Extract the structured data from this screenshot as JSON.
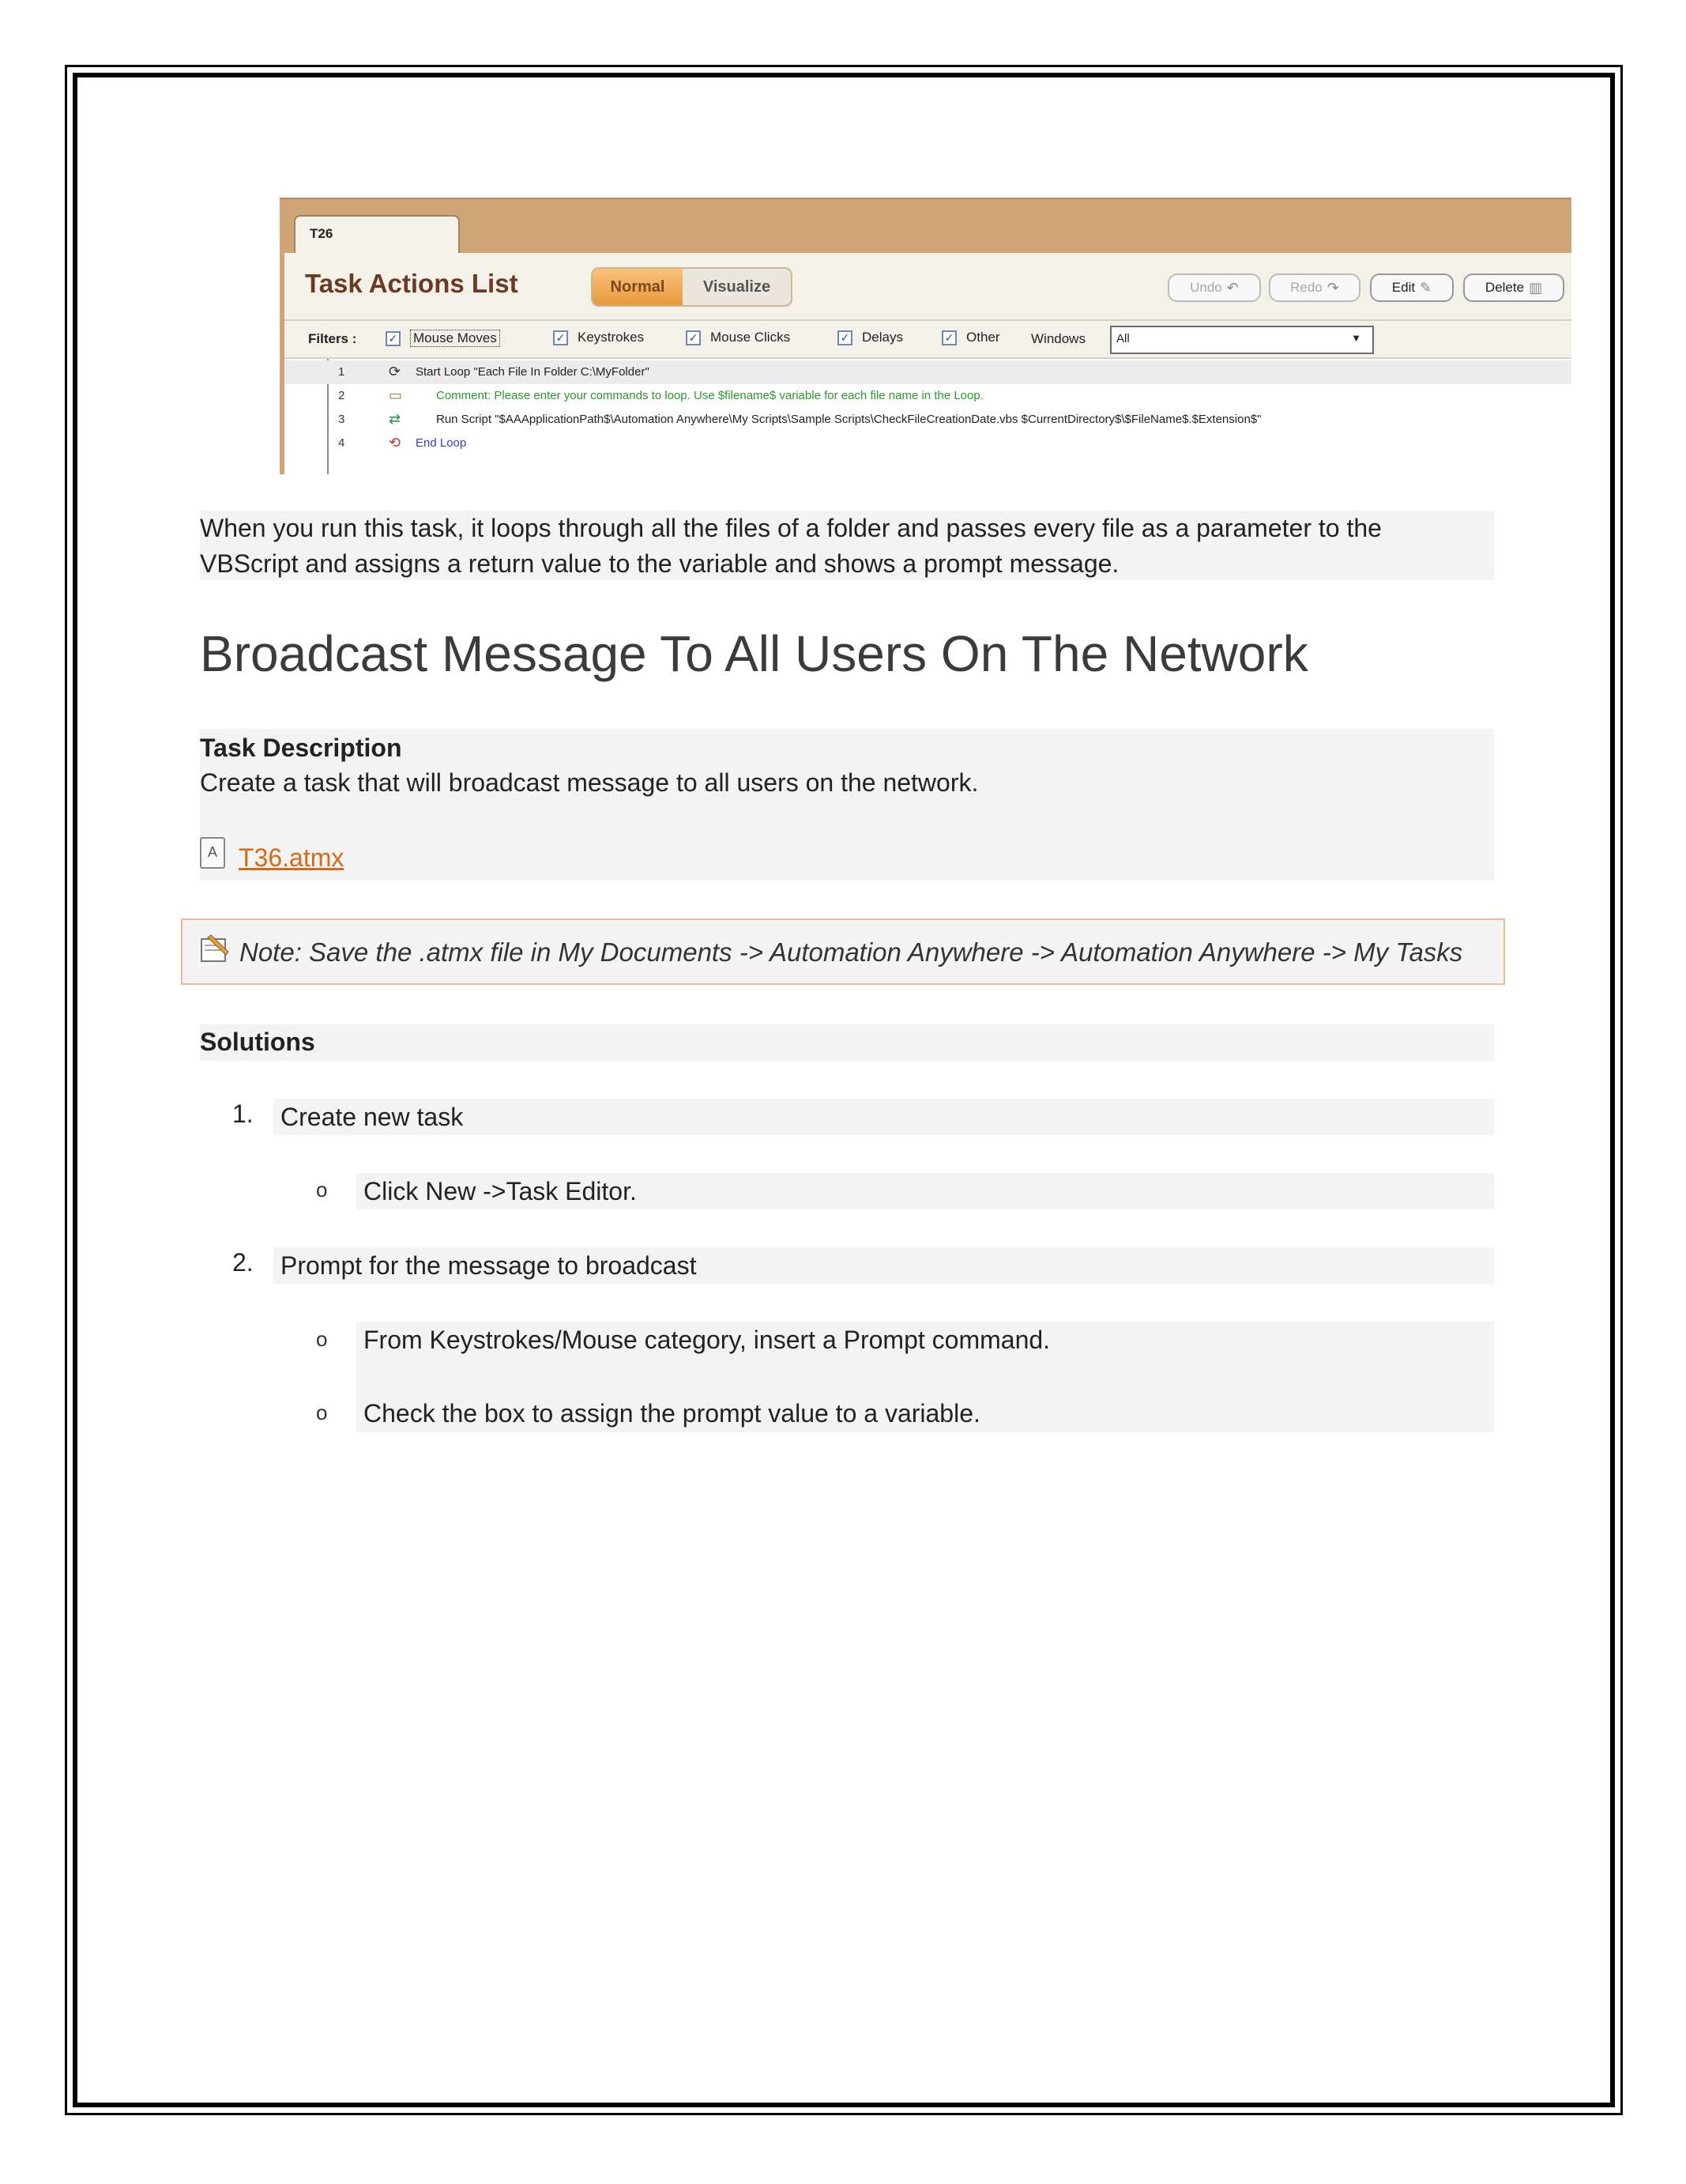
{
  "screenshot": {
    "tab_label": "T26",
    "title": "Task Actions List",
    "view_toggle": {
      "normal": "Normal",
      "visualize": "Visualize"
    },
    "buttons": {
      "undo": "Undo",
      "redo": "Redo",
      "edit": "Edit",
      "delete": "Delete"
    },
    "filters": {
      "label": "Filters :",
      "items": [
        {
          "label": "Mouse Moves",
          "checked": true
        },
        {
          "label": "Keystrokes",
          "checked": true
        },
        {
          "label": "Mouse Clicks",
          "checked": true
        },
        {
          "label": "Delays",
          "checked": true
        },
        {
          "label": "Other",
          "checked": true
        }
      ],
      "windows_label": "Windows",
      "windows_value": "All"
    },
    "actions": [
      {
        "num": "1",
        "text": "Start Loop \"Each File In Folder C:\\MyFolder\"",
        "color": "#222222"
      },
      {
        "num": "2",
        "text": "Comment: Please enter your commands to loop. Use $filename$ variable for each file name in the Loop.",
        "color": "#2a9a2a"
      },
      {
        "num": "3",
        "text": "Run Script \"$AAApplicationPath$\\Automation Anywhere\\My Scripts\\Sample Scripts\\CheckFileCreationDate.vbs $CurrentDirectory$\\$FileName$.$Extension$\"",
        "color": "#222222"
      },
      {
        "num": "4",
        "text": "End Loop",
        "color": "#2b3fd6"
      }
    ]
  },
  "intro_line1": "When you run this task, it loops through all the files of a folder and passes every file as a parameter to the",
  "intro_line2": "VBScript and assigns a return value to the variable and shows a prompt message.",
  "heading": "Broadcast Message To All Users On The Network",
  "task_description": {
    "label": "Task Description",
    "text": "Create a task that will broadcast message to all users on the network."
  },
  "attachment": "T36.atmx",
  "note": "Note: Save the .atmx file in My Documents -> Automation Anywhere -> Automation Anywhere -> My Tasks",
  "solutions": {
    "label": "Solutions",
    "steps": [
      {
        "num": "1.",
        "text": "Create new task",
        "bullets": [
          "Click New ->Task Editor."
        ]
      },
      {
        "num": "2.",
        "text": "Prompt for the message to broadcast",
        "bullets": [
          "From Keystrokes/Mouse category, insert a Prompt command.",
          "Check the box to assign the prompt value to a variable."
        ]
      }
    ],
    "bullet_glyph": "o"
  }
}
